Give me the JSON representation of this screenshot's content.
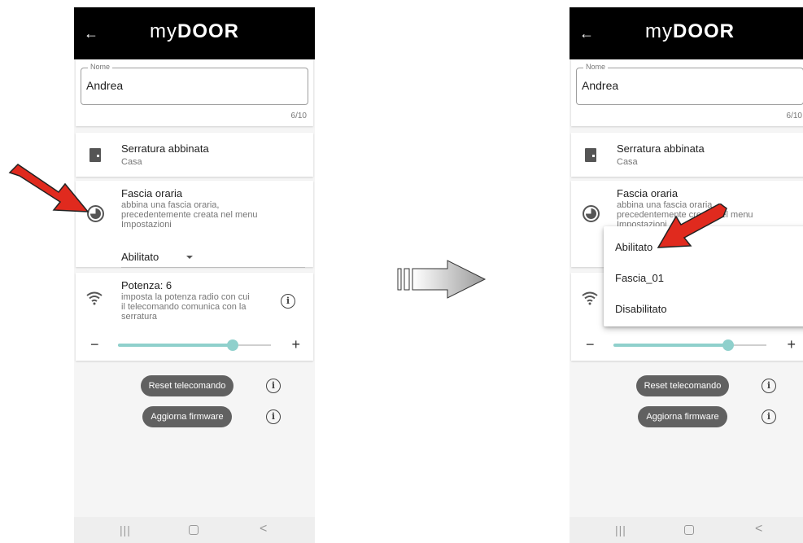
{
  "app": {
    "logo_my": "my",
    "logo_door": "DOOR",
    "back_icon": "arrow-left-icon"
  },
  "name_field": {
    "label": "Nome",
    "value": "Andrea",
    "counter": "6/10"
  },
  "lock": {
    "title": "Serratura abbinata",
    "subtitle": "Casa",
    "icon": "door-icon"
  },
  "time_slot": {
    "title": "Fascia oraria",
    "description_line1": "abbina una fascia oraria,",
    "description_line2": "precedentemente creata nel menu",
    "description_line3": "Impostazioni",
    "selected": "Abilitato",
    "icon": "clock-icon",
    "options": [
      "Abilitato",
      "Fascia_01",
      "Disabilitato"
    ]
  },
  "power": {
    "title": "Potenza: 6",
    "description_line1": "imposta la potenza radio con cui",
    "description_line2": "il telecomando comunica con la",
    "description_line3": "serratura",
    "minus": "−",
    "plus": "+",
    "level": 6,
    "max": 8,
    "icon": "wifi-icon"
  },
  "buttons": {
    "reset": "Reset telecomando",
    "update": "Aggiorna firmware",
    "info_glyph": "i"
  },
  "navbar": {
    "recent": "|||",
    "back": "<"
  },
  "colors": {
    "appbar": "#000000",
    "accent": "#8fd0cc",
    "button": "#616161",
    "arrow": "#e02a1e"
  }
}
